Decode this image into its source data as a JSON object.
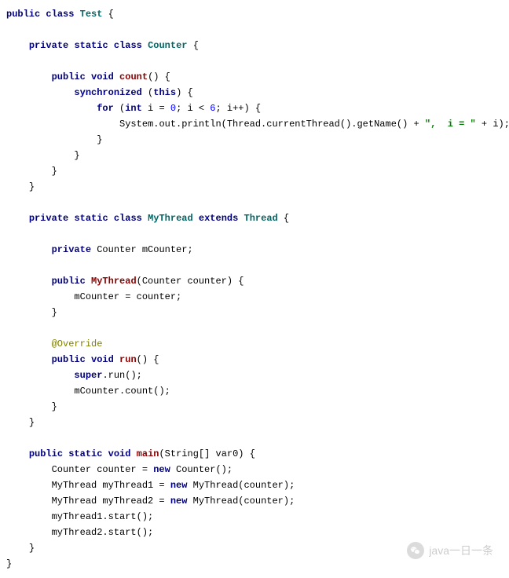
{
  "code": {
    "l1": {
      "kw1": "public",
      "kw2": "class",
      "cls": "Test",
      "t": " {"
    },
    "l3": {
      "kw1": "private",
      "kw2": "static",
      "kw3": "class",
      "cls": "Counter",
      "t": " {"
    },
    "l5": {
      "kw1": "public",
      "kw2": "void",
      "mth": "count",
      "t": "() {"
    },
    "l6": {
      "kw": "synchronized",
      "t1": " (",
      "kw2": "this",
      "t2": ") {"
    },
    "l7": {
      "kw1": "for",
      "t1": " (",
      "kw2": "int",
      "t2": " i = ",
      "n1": "0",
      "t3": "; i < ",
      "n2": "6",
      "t4": "; i++) {"
    },
    "l8": {
      "t1": "System.out.println(Thread.currentThread().getName() + ",
      "s1": "\",  i = \"",
      "t2": " + i);"
    },
    "l9": {
      "t": "}"
    },
    "l10": {
      "t": "}"
    },
    "l11": {
      "t": "}"
    },
    "l12": {
      "t": "}"
    },
    "l14": {
      "kw1": "private",
      "kw2": "static",
      "kw3": "class",
      "cls1": "MyThread",
      "kw4": "extends",
      "cls2": "Thread",
      "t": " {"
    },
    "l16": {
      "kw": "private",
      "t": " Counter mCounter;"
    },
    "l18": {
      "kw": "public",
      "mth": "MyThread",
      "t": "(Counter counter) {"
    },
    "l19": {
      "t": "mCounter = counter;"
    },
    "l20": {
      "t": "}"
    },
    "l22": {
      "ann": "@Override"
    },
    "l23": {
      "kw1": "public",
      "kw2": "void",
      "mth": "run",
      "t": "() {"
    },
    "l24": {
      "kw": "super",
      "t": ".run();"
    },
    "l25": {
      "t": "mCounter.count();"
    },
    "l26": {
      "t": "}"
    },
    "l27": {
      "t": "}"
    },
    "l29": {
      "kw1": "public",
      "kw2": "static",
      "kw3": "void",
      "mth": "main",
      "t": "(String[] var0) {"
    },
    "l30": {
      "t1": "Counter counter = ",
      "kw": "new",
      "t2": " Counter();"
    },
    "l31": {
      "t1": "MyThread myThread1 = ",
      "kw": "new",
      "t2": " MyThread(counter);"
    },
    "l32": {
      "t1": "MyThread myThread2 = ",
      "kw": "new",
      "t2": " MyThread(counter);"
    },
    "l33": {
      "t": "myThread1.start();"
    },
    "l34": {
      "t": "myThread2.start();"
    },
    "l35": {
      "t": "}"
    },
    "l36": {
      "t": "}"
    }
  },
  "watermark": {
    "text": "java一日一条"
  }
}
